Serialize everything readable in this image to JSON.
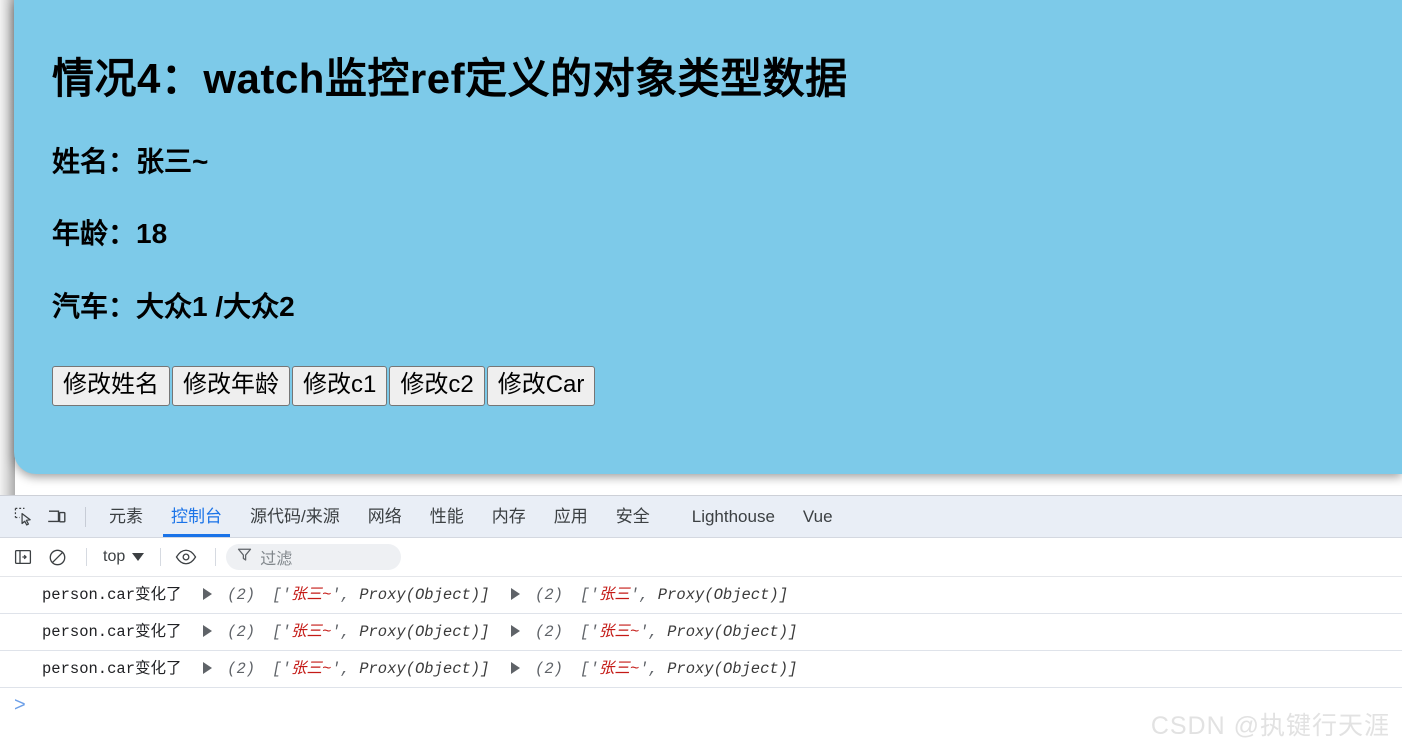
{
  "page": {
    "title": "情况4：watch监控ref定义的对象类型数据",
    "fields": [
      {
        "label": "姓名：",
        "value": "张三~",
        "text": "姓名：张三~"
      },
      {
        "label": "年龄：",
        "value": "18",
        "text": "年龄：18"
      },
      {
        "label": "汽车：",
        "value": "大众1 /大众2",
        "text": "汽车：大众1 /大众2"
      }
    ],
    "buttons": [
      {
        "label": "修改姓名"
      },
      {
        "label": "修改年龄"
      },
      {
        "label": "修改c1"
      },
      {
        "label": "修改c2"
      },
      {
        "label": "修改Car"
      }
    ],
    "panel_color": "#7dcae9"
  },
  "devtools": {
    "icons": {
      "inspect": "inspect-element-icon",
      "device": "device-toolbar-icon",
      "sidebar": "console-sidebar-icon",
      "clear": "clear-console-icon",
      "eye": "live-expression-eye-icon",
      "filter": "filter-funnel-icon"
    },
    "tabs": [
      {
        "label": "元素",
        "active": false
      },
      {
        "label": "控制台",
        "active": true
      },
      {
        "label": "源代码/来源",
        "active": false
      },
      {
        "label": "网络",
        "active": false
      },
      {
        "label": "性能",
        "active": false
      },
      {
        "label": "内存",
        "active": false
      },
      {
        "label": "应用",
        "active": false
      },
      {
        "label": "安全",
        "active": false
      },
      {
        "label": "Lighthouse",
        "active": false
      },
      {
        "label": "Vue",
        "active": false
      }
    ],
    "active_tab_color": "#1a73e8",
    "filterbar": {
      "context": "top",
      "filter_placeholder": "过滤"
    },
    "console_logs": [
      {
        "message": "person.car变化了",
        "groups": [
          {
            "count": "(2)",
            "open_bracket": "['",
            "string": "张三~",
            "close_string": "', ",
            "proxy": "Proxy(Object)]"
          },
          {
            "count": "(2)",
            "open_bracket": "['",
            "string": "张三",
            "close_string": "', ",
            "proxy": "Proxy(Object)]"
          }
        ]
      },
      {
        "message": "person.car变化了",
        "groups": [
          {
            "count": "(2)",
            "open_bracket": "['",
            "string": "张三~",
            "close_string": "', ",
            "proxy": "Proxy(Object)]"
          },
          {
            "count": "(2)",
            "open_bracket": "['",
            "string": "张三~",
            "close_string": "', ",
            "proxy": "Proxy(Object)]"
          }
        ]
      },
      {
        "message": "person.car变化了",
        "groups": [
          {
            "count": "(2)",
            "open_bracket": "['",
            "string": "张三~",
            "close_string": "', ",
            "proxy": "Proxy(Object)]"
          },
          {
            "count": "(2)",
            "open_bracket": "['",
            "string": "张三~",
            "close_string": "', ",
            "proxy": "Proxy(Object)]"
          }
        ]
      }
    ],
    "prompt": ">"
  },
  "watermark": "CSDN @执键行天涯"
}
